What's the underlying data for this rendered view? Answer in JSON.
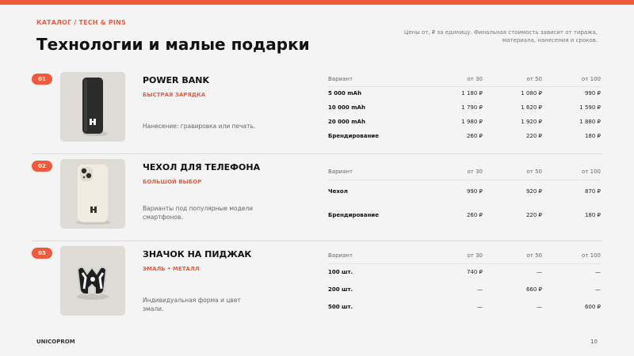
{
  "header": {
    "breadcrumb": "КАТАЛОГ / TECH & PINS",
    "title": "Технологии и малые подарки",
    "note_line1": "Цены от, ₽ за единицу. Финальная стоимость зависит от тиража,",
    "note_line2": "материала, нанесения и сроков."
  },
  "colors": {
    "accent": "#f05a3c",
    "background": "#f4f4f4"
  },
  "products": [
    {
      "number": "01",
      "name": "POWER BANK",
      "tag": "БЫСТРАЯ ЗАРЯДКА",
      "description": "Нанесение: гравировка или печать.",
      "photo_icon": "power-bank-photo",
      "columns": [
        "Вариант",
        "от 30",
        "от 50",
        "от 100"
      ],
      "rows": [
        [
          "5 000 mAh",
          "1 180 ₽",
          "1 080 ₽",
          "990 ₽"
        ],
        [
          "10 000 mAh",
          "1 790 ₽",
          "1 620 ₽",
          "1 590 ₽"
        ],
        [
          "20 000 mAh",
          "1 980 ₽",
          "1 920 ₽",
          "1 880 ₽"
        ],
        [
          "Брендирование",
          "260 ₽",
          "220 ₽",
          "180 ₽"
        ]
      ]
    },
    {
      "number": "02",
      "name": "ЧЕХОЛ ДЛЯ ТЕЛЕФОНА",
      "tag": "БОЛЬШОЙ ВЫБОР",
      "description": "Варианты под популярные модели смартфонов.",
      "photo_icon": "phone-case-photo",
      "columns": [
        "Вариант",
        "от 30",
        "от 50",
        "от 100"
      ],
      "rows": [
        [
          "Чехол",
          "990 ₽",
          "920 ₽",
          "870 ₽"
        ],
        [
          "Брендирование",
          "260 ₽",
          "220 ₽",
          "180 ₽"
        ]
      ]
    },
    {
      "number": "03",
      "name": "ЗНАЧОК НА ПИДЖАК",
      "tag": "ЭМАЛЬ • МЕТАЛЛ",
      "description": "Индивидуальная форма и цвет эмали.",
      "photo_icon": "enamel-pin-photo",
      "columns": [
        "Вариант",
        "от 30",
        "от 50",
        "от 100"
      ],
      "rows": [
        [
          "100 шт.",
          "740 ₽",
          "—",
          "—"
        ],
        [
          "200 шт.",
          "—",
          "660 ₽",
          "—"
        ],
        [
          "500 шт.",
          "—",
          "—",
          "600 ₽"
        ]
      ]
    }
  ],
  "footer": {
    "brand": "UNICOPROM",
    "page": "10"
  }
}
